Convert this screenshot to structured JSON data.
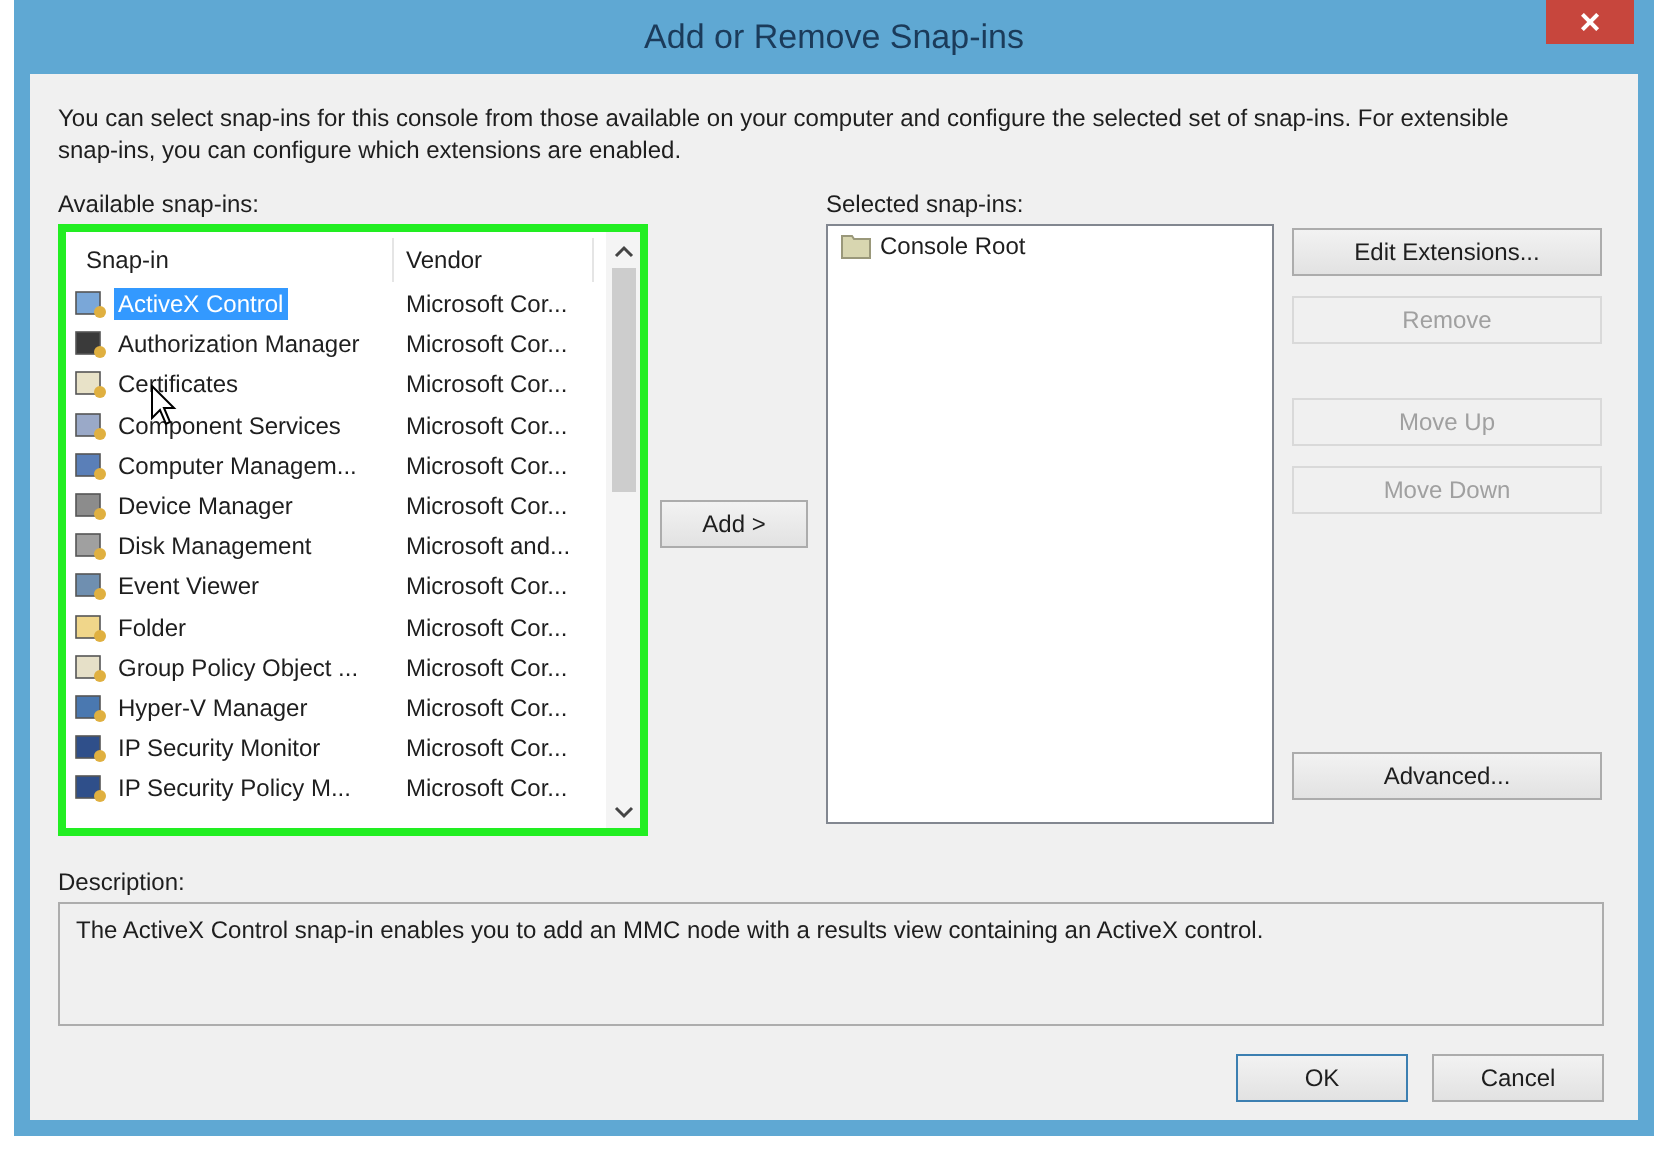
{
  "window": {
    "title": "Add or Remove Snap-ins",
    "close": "×"
  },
  "intro": "You can select snap-ins for this console from those available on your computer and configure the selected set of snap-ins. For extensible snap-ins, you can configure which extensions are enabled.",
  "available": {
    "label": "Available snap-ins:",
    "highlighted": true,
    "columns": [
      "Snap-in",
      "Vendor"
    ],
    "rows": [
      {
        "name": "ActiveX Control",
        "vendor": "Microsoft Cor...",
        "selected": true
      },
      {
        "name": "Authorization Manager",
        "vendor": "Microsoft Cor...",
        "selected": false
      },
      {
        "name": "Certificates",
        "vendor": "Microsoft Cor...",
        "selected": false
      },
      {
        "name": "Component Services",
        "vendor": "Microsoft Cor...",
        "selected": false
      },
      {
        "name": "Computer Managem...",
        "vendor": "Microsoft Cor...",
        "selected": false
      },
      {
        "name": "Device Manager",
        "vendor": "Microsoft Cor...",
        "selected": false
      },
      {
        "name": "Disk Management",
        "vendor": "Microsoft and...",
        "selected": false
      },
      {
        "name": "Event Viewer",
        "vendor": "Microsoft Cor...",
        "selected": false
      },
      {
        "name": "Folder",
        "vendor": "Microsoft Cor...",
        "selected": false
      },
      {
        "name": "Group Policy Object ...",
        "vendor": "Microsoft Cor...",
        "selected": false
      },
      {
        "name": "Hyper-V Manager",
        "vendor": "Microsoft Cor...",
        "selected": false
      },
      {
        "name": "IP Security Monitor",
        "vendor": "Microsoft Cor...",
        "selected": false
      },
      {
        "name": "IP Security Policy M...",
        "vendor": "Microsoft Cor...",
        "selected": false
      }
    ]
  },
  "add_button": "Add >",
  "selected_snapins": {
    "label": "Selected snap-ins:",
    "items": [
      {
        "name": "Console Root"
      }
    ]
  },
  "side_buttons": [
    {
      "label": "Edit Extensions...",
      "disabled": false
    },
    {
      "label": "Remove",
      "disabled": true
    },
    {
      "label": "Move Up",
      "disabled": true
    },
    {
      "label": "Move Down",
      "disabled": true
    },
    {
      "label": "Advanced...",
      "disabled": false
    }
  ],
  "description": {
    "label": "Description:",
    "text": "The ActiveX Control snap-in enables you to add an MMC node with a results view containing an ActiveX control."
  },
  "footer_buttons": [
    {
      "label": "OK",
      "default": true
    },
    {
      "label": "Cancel",
      "default": false
    }
  ]
}
